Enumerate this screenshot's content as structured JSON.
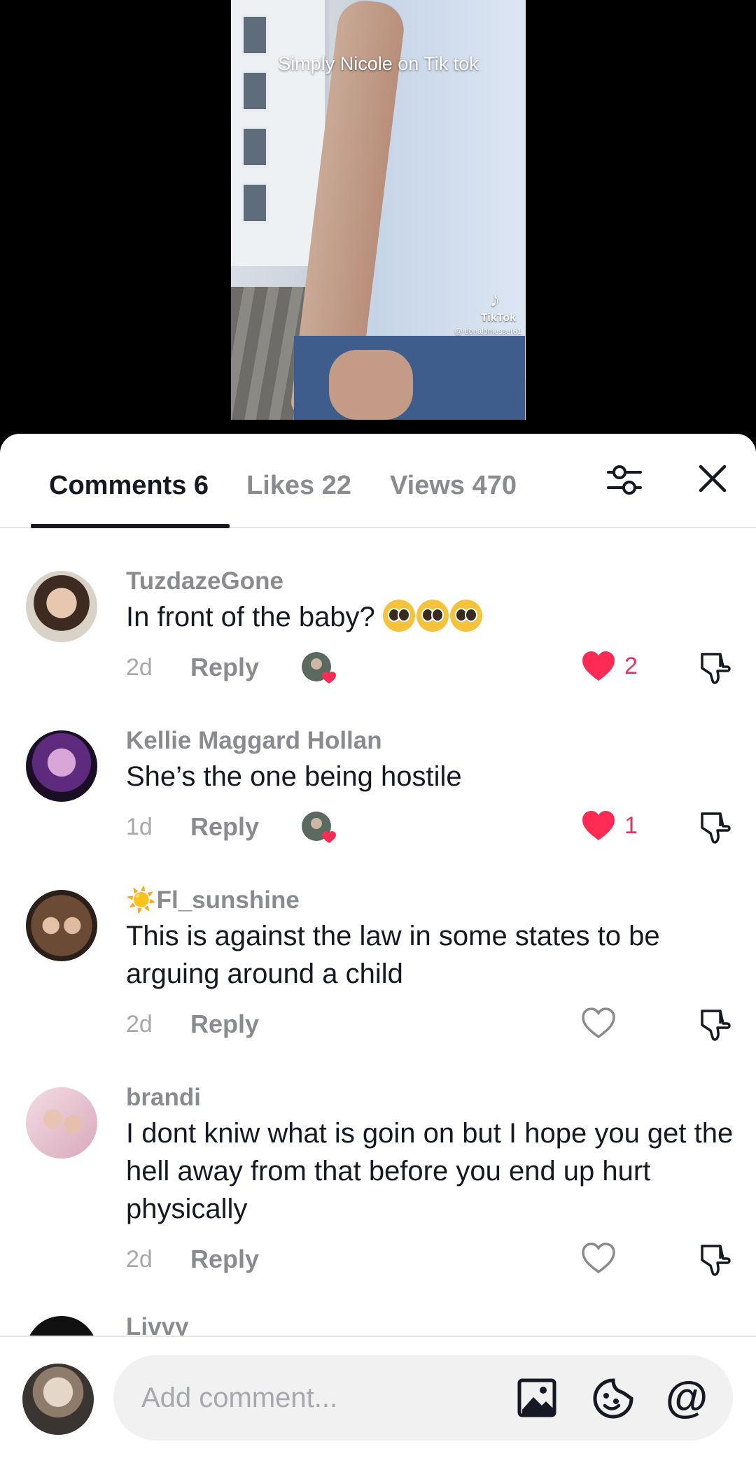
{
  "video": {
    "caption": "Simply Nicole on Tik tok",
    "watermark_logo": "TikTok",
    "watermark_handle": "@ donaldmesser61"
  },
  "tabs": [
    {
      "label": "Comments 6",
      "active": true
    },
    {
      "label": "Likes 22",
      "active": false
    },
    {
      "label": "Views 470",
      "active": false
    }
  ],
  "icons": {
    "filter": "sliders-icon",
    "close": "close-icon",
    "like": "heart-icon",
    "dislike": "thumbs-down-icon",
    "image": "image-icon",
    "sticker": "sticker-icon",
    "mention": "at-icon"
  },
  "colors": {
    "like_active": "#fe2c55",
    "text_primary": "#161823",
    "text_secondary": "#8a8b91"
  },
  "comments": [
    {
      "user": "TuzdazeGone",
      "text": "In front of the baby? ",
      "emoji": "pleading-face-emoji x3",
      "time": "2d",
      "reply": "Reply",
      "creator_liked": true,
      "liked": true,
      "likes": "2"
    },
    {
      "user": "Kellie Maggard Hollan",
      "text": "She’s the one being hostile",
      "time": "1d",
      "reply": "Reply",
      "creator_liked": true,
      "liked": true,
      "likes": "1"
    },
    {
      "user": "Fl_sunshine",
      "user_prefix_emoji": "☀️",
      "text": "This is against the law in some states to be arguing around a child",
      "time": "2d",
      "reply": "Reply",
      "creator_liked": false,
      "liked": false,
      "likes": ""
    },
    {
      "user": "brandi",
      "text": "I dont kniw what is goin on but I hope you get the hell away from that before you end up hurt physically",
      "time": "2d",
      "reply": "Reply",
      "creator_liked": false,
      "liked": false,
      "likes": ""
    },
    {
      "user": "Livvy"
    }
  ],
  "composer": {
    "placeholder": "Add comment..."
  }
}
